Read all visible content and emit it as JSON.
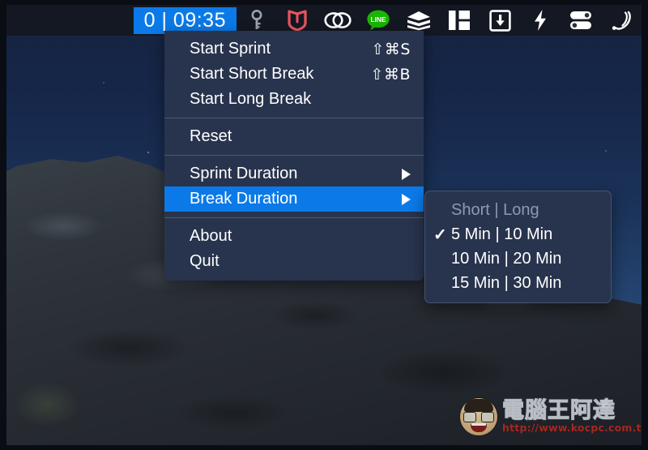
{
  "menubar": {
    "timer_badge": {
      "name": "pomodoro-timer-badge",
      "text": "0 | 09:35",
      "background_color": "#0b7ae8",
      "text_color": "#ffffff"
    },
    "tray_icons": [
      {
        "name": "key-icon",
        "title": "1Password"
      },
      {
        "name": "shield-icon",
        "title": "McAfee"
      },
      {
        "name": "creative-cloud-icon",
        "title": "Adobe Creative Cloud"
      },
      {
        "name": "line-icon",
        "title": "LINE",
        "label": "LINE"
      },
      {
        "name": "layers-icon",
        "title": "Stacks"
      },
      {
        "name": "panels-icon",
        "title": "Window Layout"
      },
      {
        "name": "download-icon",
        "title": "Downloads"
      },
      {
        "name": "bolt-icon",
        "title": "Power"
      },
      {
        "name": "toggles-icon",
        "title": "Toggles"
      },
      {
        "name": "spring-icon",
        "title": "Spring"
      }
    ],
    "background_color": "#141822"
  },
  "main_menu": {
    "name": "pomodoro-menu",
    "groups": [
      {
        "items": [
          {
            "label": "Start Sprint",
            "shortcut": "⇧⌘S",
            "selected": false,
            "submenu": false
          },
          {
            "label": "Start Short Break",
            "shortcut": "⇧⌘B",
            "selected": false,
            "submenu": false
          },
          {
            "label": "Start Long Break",
            "shortcut": "",
            "selected": false,
            "submenu": false
          }
        ]
      },
      {
        "items": [
          {
            "label": "Reset",
            "shortcut": "",
            "selected": false,
            "submenu": false
          }
        ]
      },
      {
        "items": [
          {
            "label": "Sprint Duration",
            "shortcut": "",
            "selected": false,
            "submenu": true
          },
          {
            "label": "Break Duration",
            "shortcut": "",
            "selected": true,
            "submenu": true
          }
        ]
      },
      {
        "items": [
          {
            "label": "About",
            "shortcut": "",
            "selected": false,
            "submenu": false
          },
          {
            "label": "Quit",
            "shortcut": "",
            "selected": false,
            "submenu": false
          }
        ]
      }
    ],
    "highlight_color": "#0b7ae8",
    "background_color": "#28344d"
  },
  "submenu": {
    "name": "break-duration-submenu",
    "header": {
      "label": "Short | Long",
      "enabled": false
    },
    "options": [
      {
        "label": "5 Min | 10 Min",
        "checked": true
      },
      {
        "label": "10 Min | 20 Min",
        "checked": false
      },
      {
        "label": "15 Min | 30 Min",
        "checked": false
      }
    ],
    "check_glyph": "✓"
  },
  "watermark": {
    "name": "site-watermark",
    "title": "電腦王阿達",
    "url": "http://www.kocpc.com.tw",
    "url_color": "#b02a23"
  }
}
